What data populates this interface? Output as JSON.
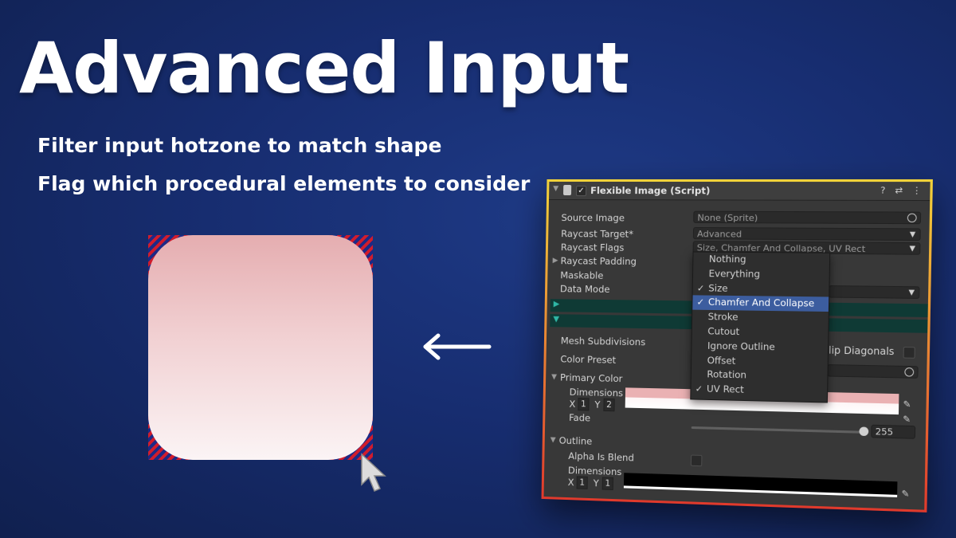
{
  "hero": {
    "title": "Advanced Input",
    "subtitle_1": "Filter input hotzone to match shape",
    "subtitle_2": "Flag which procedural elements to consider"
  },
  "colors": {
    "hotzone_stripe_red": "#d11c2c",
    "hotzone_stripe_blue": "#1d2a86",
    "panel_border_top": "#f2d23a",
    "panel_border_bottom": "#e03a2c",
    "menu_highlight": "#3c5d9f",
    "primary_swatch": "#eab1b3"
  },
  "inspector": {
    "component_title": "Flexible Image (Script)",
    "enabled_check": "✓",
    "header_icons": [
      "help-icon",
      "presets-icon",
      "more-icon"
    ],
    "source_image": {
      "label": "Source Image",
      "value": "None (Sprite)"
    },
    "raycast_target": {
      "label": "Raycast Target*",
      "value": "Advanced"
    },
    "raycast_flags": {
      "label": "Raycast Flags",
      "value": "Size, Chamfer And Collapse, UV Rect"
    },
    "raycast_padding": {
      "label": "Raycast Padding"
    },
    "maskable": {
      "label": "Maskable"
    },
    "data_mode": {
      "label": "Data Mode"
    },
    "mesh_subdivisions": {
      "label": "Mesh Subdivisions"
    },
    "flip_diagonals": {
      "label": "lip Diagonals"
    },
    "color_preset": {
      "label": "Color Preset"
    },
    "primary_color": {
      "label": "Primary Color",
      "dimensions_label": "Dimensions",
      "x_label": "X",
      "x_value": "1",
      "y_label": "Y",
      "y_value": "2",
      "fade_label": "Fade",
      "fade_value": "255",
      "fade_fraction": 1.0
    },
    "outline": {
      "label": "Outline",
      "alpha_is_blend_label": "Alpha Is Blend",
      "dimensions_label": "Dimensions",
      "x_label": "X",
      "x_value": "1",
      "y_label": "Y",
      "y_value": "1"
    },
    "flags_menu": {
      "items": [
        {
          "label": "Nothing",
          "check": ""
        },
        {
          "label": "Everything",
          "check": ""
        },
        {
          "label": "Size",
          "check": "✓"
        },
        {
          "label": "Chamfer And Collapse",
          "check": "✓"
        },
        {
          "label": "Stroke",
          "check": ""
        },
        {
          "label": "Cutout",
          "check": ""
        },
        {
          "label": "Ignore Outline",
          "check": ""
        },
        {
          "label": "Offset",
          "check": ""
        },
        {
          "label": "Rotation",
          "check": ""
        },
        {
          "label": "UV Rect",
          "check": "✓"
        }
      ],
      "highlighted": "Chamfer And Collapse"
    }
  }
}
